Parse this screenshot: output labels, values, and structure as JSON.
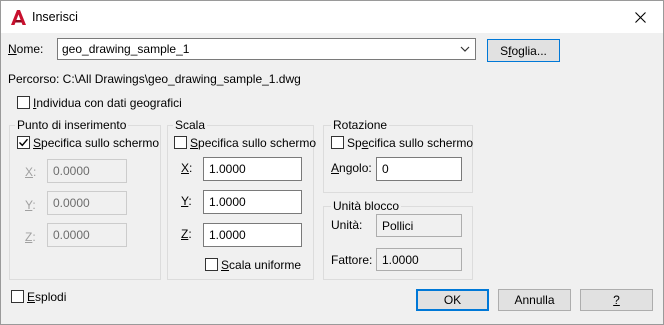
{
  "window": {
    "title": "Inserisci"
  },
  "name_row": {
    "label": "Nome:",
    "value": "geo_drawing_sample_1",
    "browse_label": "Sfoglia..."
  },
  "path": {
    "text": "Percorso: C:\\All Drawings\\geo_drawing_sample_1.dwg"
  },
  "geo": {
    "label": "Individua con dati geografici",
    "checked": false
  },
  "insertion": {
    "title": "Punto di inserimento",
    "specify_label": "Specifica sullo schermo",
    "specify_checked": true,
    "x_label": "X:",
    "x_value": "0.0000",
    "y_label": "Y:",
    "y_value": "0.0000",
    "z_label": "Z:",
    "z_value": "0.0000"
  },
  "scale": {
    "title": "Scala",
    "specify_label": "Specifica sullo schermo",
    "specify_checked": false,
    "x_label": "X:",
    "x_value": "1.0000",
    "y_label": "Y:",
    "y_value": "1.0000",
    "z_label": "Z:",
    "z_value": "1.0000",
    "uniform_label": "Scala uniforme",
    "uniform_checked": false
  },
  "rotation": {
    "title": "Rotazione",
    "specify_label": "Specifica sullo schermo",
    "specify_checked": false,
    "angle_label": "Angolo:",
    "angle_value": "0"
  },
  "block_unit": {
    "title": "Unità blocco",
    "unit_label": "Unità:",
    "unit_value": "Pollici",
    "factor_label": "Fattore:",
    "factor_value": "1.0000"
  },
  "explode": {
    "label": "Esplodi",
    "checked": false
  },
  "buttons": {
    "ok": "OK",
    "cancel": "Annulla",
    "help": "?"
  },
  "colors": {
    "accent": "#0078d7",
    "app_icon": "#c8102e"
  }
}
